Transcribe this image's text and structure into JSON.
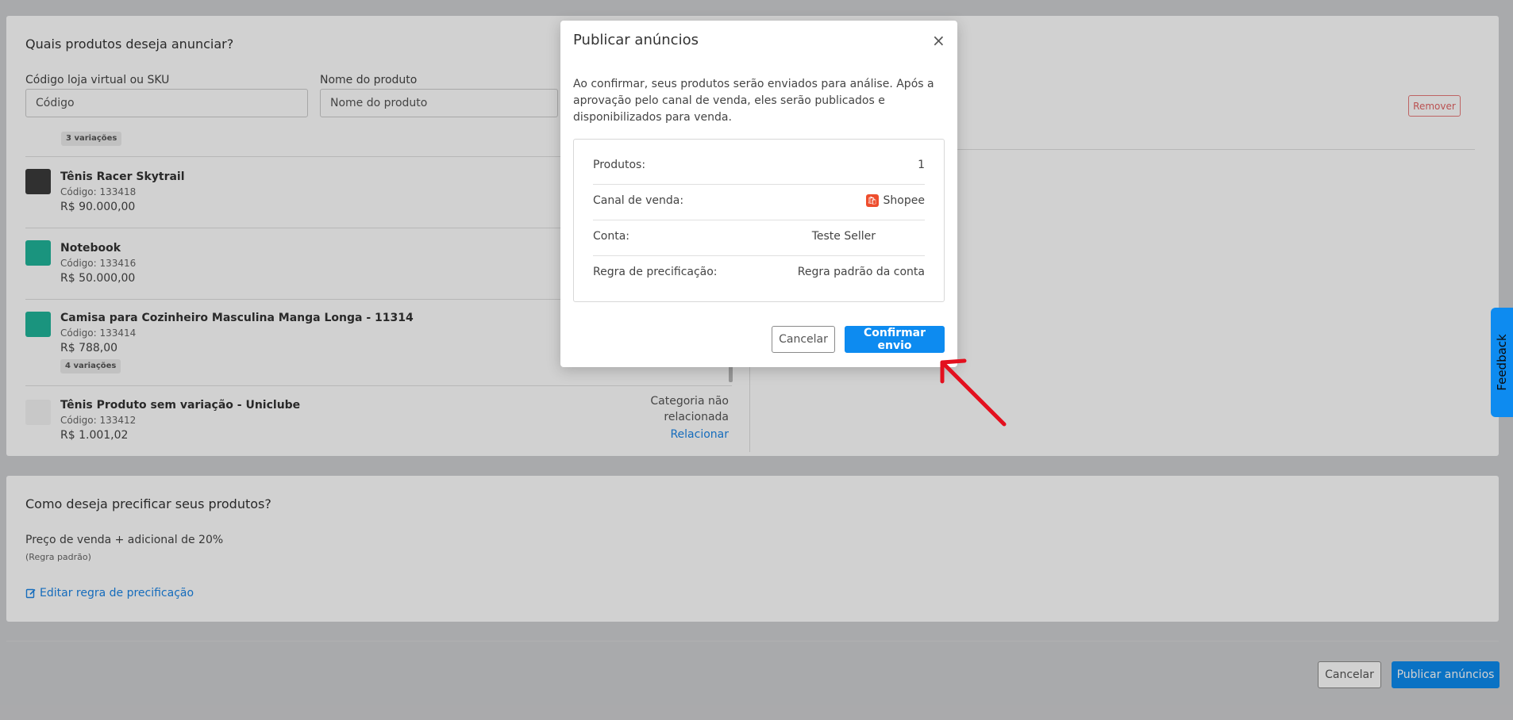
{
  "products_section": {
    "title": "Quais produtos deseja anunciar?",
    "sku_label": "Código loja virtual ou SKU",
    "sku_placeholder": "Código",
    "name_label": "Nome do produto",
    "name_placeholder": "Nome do produto",
    "top_badge": "3 variações",
    "items": [
      {
        "name": "Tênis Racer Skytrail",
        "code": "Código: 133418",
        "price": "R$ 90.000,00"
      },
      {
        "name": "Notebook",
        "code": "Código: 133416",
        "price": "R$ 50.000,00"
      },
      {
        "name": "Camisa para Cozinheiro Masculina Manga Longa - 11314",
        "code": "Código: 133414",
        "price": "R$ 788,00",
        "badge": "4 variações"
      },
      {
        "name": "Tênis Produto sem variação - Uniclube",
        "code": "Código: 133412",
        "price": "R$ 1.001,02",
        "category_status": "Categoria não relacionada",
        "relate_link": "Relacionar"
      }
    ],
    "remove_button": "Remover"
  },
  "pricing_section": {
    "title": "Como deseja precificar seus produtos?",
    "rule": "Preço de venda + adicional de 20%",
    "rule_note": "(Regra padrão)",
    "edit_link": "Editar regra de precificação"
  },
  "footer": {
    "cancel": "Cancelar",
    "publish": "Publicar anúncios"
  },
  "modal": {
    "title": "Publicar anúncios",
    "close_glyph": "×",
    "description": "Ao confirmar, seus produtos serão enviados para análise. Após a aprovação pelo canal de venda, eles serão publicados e disponibilizados para venda.",
    "rows": [
      {
        "label": "Produtos:",
        "value": "1"
      },
      {
        "label": "Canal de venda:",
        "value": "Shopee",
        "icon": "shopee-icon"
      },
      {
        "label": "Conta:",
        "value": "Teste Seller"
      },
      {
        "label": "Regra de precificação:",
        "value": "Regra padrão da conta"
      }
    ],
    "cancel": "Cancelar",
    "confirm": "Confirmar envio"
  },
  "feedback": {
    "label": "Feedback"
  },
  "colors": {
    "primary": "#0d8bf0",
    "annotation_arrow": "#e3101e",
    "remove": "#e36464",
    "shopee": "#ee4d2d"
  }
}
